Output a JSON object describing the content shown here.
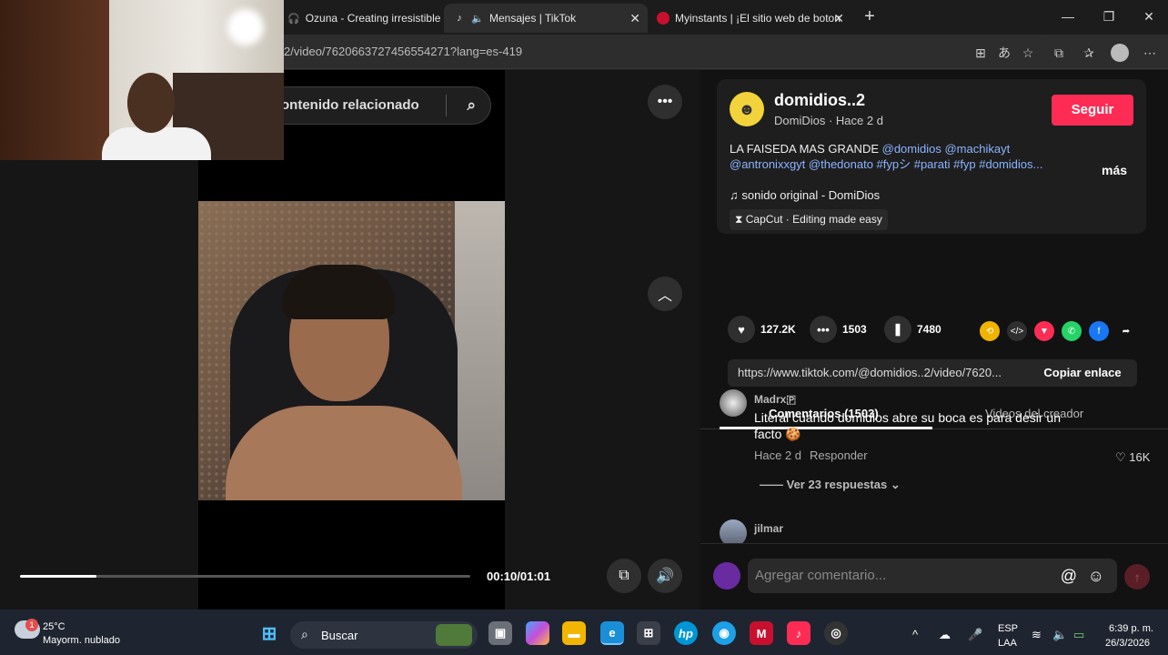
{
  "browser": {
    "tabs": [
      {
        "title": "Ozuna - Creating irresistible",
        "icon": "headphones-icon"
      },
      {
        "title": "Mensajes | TikTok",
        "icon": "tiktok-icon",
        "audio": true
      },
      {
        "title": "Myinstants | ¡El sitio web de boton",
        "icon": "myinstants-icon"
      }
    ],
    "url": "2/video/7620663727456554271?lang=es-419"
  },
  "video": {
    "search_placeholder": "ontenido relacionado",
    "time": "00:10/01:01",
    "progress": 0.17
  },
  "post": {
    "username": "domidios..2",
    "nickname_line": "DomiDios · Hace 2 d",
    "follow_label": "Seguir",
    "desc_plain": "LA FAISEDA MAS GRANDE ",
    "desc_tags_1": "@domidios @machikayt",
    "desc_tags_2": "@antronixxgyt @thedonato #fypシ #parati #fyp #domidios...",
    "more_label": "más",
    "music": "sonido original - DomiDios",
    "capcut": "CapCut · Editing made easy",
    "likes": "127.2K",
    "comments": "1503",
    "saves": "7480",
    "link": "https://www.tiktok.com/@domidios..2/video/7620...",
    "copy_label": "Copiar enlace"
  },
  "tabs_panel": {
    "comments_tab": "Comentarios (1503)",
    "creator_tab": "Videos del creador"
  },
  "comments": [
    {
      "user": "Madrx🇵",
      "text_1": "Literal cuando domidios abre su boca es para desir un",
      "text_2": "facto 🍪",
      "time": "Hace 2 d",
      "reply": "Responder",
      "likes": "16K",
      "replies": "Ver 23 respuestas"
    },
    {
      "user": "jilmar"
    }
  ],
  "composer": {
    "placeholder": "Agregar comentario..."
  },
  "taskbar": {
    "weather_temp": "25°C",
    "weather_desc": "Mayorm. nublado",
    "weather_badge": "1",
    "search_label": "Buscar",
    "lang_1": "ESP",
    "lang_2": "LAA",
    "clock_time": "6:39 p. m.",
    "clock_date": "26/3/2026"
  },
  "colors": {
    "accent": "#fe2c55",
    "tag": "#8ab4ff"
  }
}
